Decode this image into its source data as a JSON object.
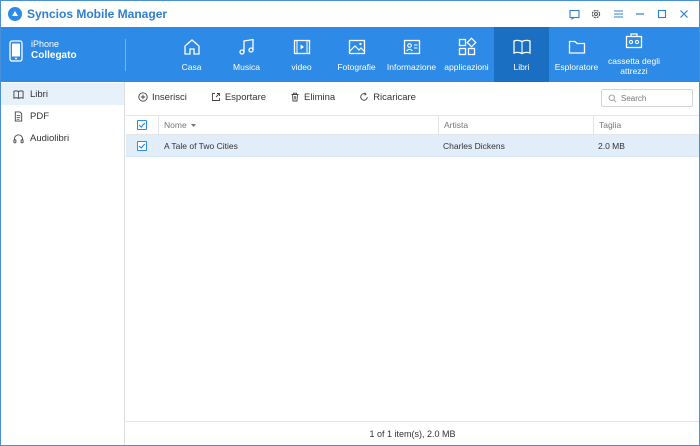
{
  "app": {
    "title": "Syncios Mobile Manager"
  },
  "device": {
    "name": "iPhone",
    "status": "Collegato"
  },
  "nav": {
    "items": [
      {
        "label": "Casa",
        "icon": "home-icon"
      },
      {
        "label": "Musica",
        "icon": "music-icon"
      },
      {
        "label": "video",
        "icon": "video-icon"
      },
      {
        "label": "Fotografie",
        "icon": "photo-icon"
      },
      {
        "label": "Informazione",
        "icon": "contact-card-icon"
      },
      {
        "label": "applicazioni",
        "icon": "apps-icon"
      },
      {
        "label": "Libri",
        "icon": "book-icon",
        "active": true
      },
      {
        "label": "Esploratore",
        "icon": "folder-icon"
      },
      {
        "label": "cassetta degli attrezzi",
        "icon": "toolbox-icon"
      }
    ]
  },
  "sidebar": {
    "items": [
      {
        "label": "Libri",
        "icon": "book-icon",
        "active": true
      },
      {
        "label": "PDF",
        "icon": "document-icon"
      },
      {
        "label": "Audiolibri",
        "icon": "headphones-icon"
      }
    ]
  },
  "toolbar": {
    "insert": "Inserisci",
    "export": "Esportare",
    "delete": "Elimina",
    "refresh": "Ricaricare",
    "search_placeholder": "Search"
  },
  "table": {
    "columns": {
      "name": "Nome",
      "artist": "Artista",
      "size": "Taglia"
    },
    "rows": [
      {
        "name": "A Tale of Two Cities",
        "artist": "Charles Dickens",
        "size": "2.0 MB",
        "checked": true
      }
    ]
  },
  "status": {
    "text": "1 of 1 item(s), 2.0 MB"
  },
  "colors": {
    "accent": "#2d8ae6",
    "nav_active": "#1b6fc2",
    "row_selected": "#e1eefa"
  }
}
